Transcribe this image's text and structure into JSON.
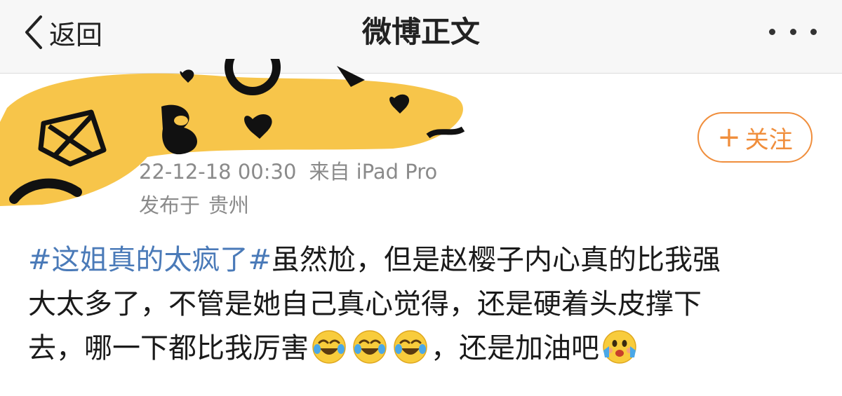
{
  "navbar": {
    "back_label": "返回",
    "title": "微博正文",
    "back_icon": "chevron-left-icon",
    "more_icon": "more-dots-icon"
  },
  "author": {
    "avatar_redacted": true,
    "follow_label": "关注",
    "follow_plus": "+",
    "accent_color": "#f08e3c"
  },
  "meta": {
    "timestamp": "22-12-18 00:30",
    "source": "来自 iPad Pro",
    "location_prefix": "发布于",
    "location": "贵州"
  },
  "post": {
    "topic": "#这姐真的太疯了#",
    "line1_text": "虽然尬，但是赵樱子内心真的比我强",
    "line2_text": "大太多了，不管是她自己真心觉得，还是硬着头皮撑下",
    "line3_text": "去，哪一下都比我厉害",
    "line3_after_emoji": "，还是加油吧",
    "topic_color": "#4a7ab8",
    "emojis": [
      "laugh-cry-emoji-icon",
      "laugh-cry-emoji-icon",
      "laugh-cry-emoji-icon",
      "excited-emoji-icon"
    ]
  }
}
